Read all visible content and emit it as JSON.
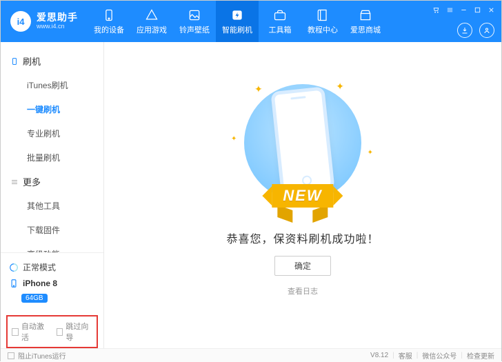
{
  "logo": {
    "badge": "i4",
    "title": "爱思助手",
    "url": "www.i4.cn"
  },
  "nav": {
    "items": [
      {
        "label": "我的设备"
      },
      {
        "label": "应用游戏"
      },
      {
        "label": "铃声壁纸"
      },
      {
        "label": "智能刷机"
      },
      {
        "label": "工具箱"
      },
      {
        "label": "教程中心"
      },
      {
        "label": "爱思商城"
      }
    ]
  },
  "sidebar": {
    "cat1": {
      "label": "刷机"
    },
    "items1": [
      {
        "label": "iTunes刷机"
      },
      {
        "label": "一键刷机"
      },
      {
        "label": "专业刷机"
      },
      {
        "label": "批量刷机"
      }
    ],
    "cat2": {
      "label": "更多"
    },
    "items2": [
      {
        "label": "其他工具"
      },
      {
        "label": "下载固件"
      },
      {
        "label": "高级功能"
      }
    ],
    "mode": "正常模式",
    "device": "iPhone 8",
    "storage": "64GB",
    "options": {
      "auto_activate": "自动激活",
      "skip_setup": "跳过向导"
    }
  },
  "main": {
    "ribbon": "NEW",
    "success": "恭喜您，保资料刷机成功啦！",
    "confirm": "确定",
    "view_log": "查看日志"
  },
  "statusbar": {
    "block_itunes": "阻止iTunes运行",
    "version": "V8.12",
    "support": "客服",
    "wechat": "微信公众号",
    "update": "检查更新"
  }
}
